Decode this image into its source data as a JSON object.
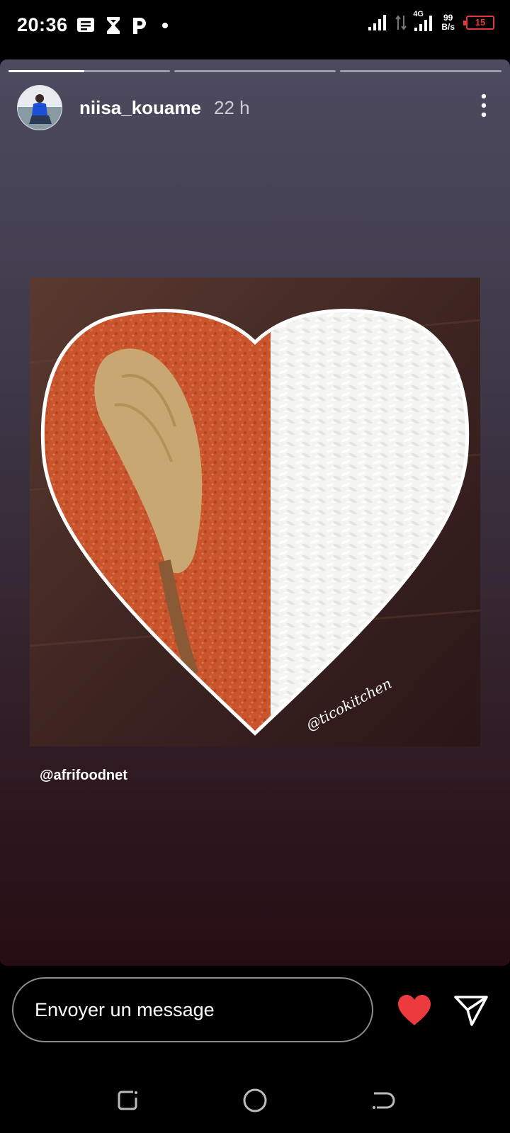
{
  "status_bar": {
    "time": "20:36",
    "network_type": "4G",
    "net_speed_value": "99",
    "net_speed_unit": "B/s",
    "battery_level": "15",
    "battery_color": "#e23a3a",
    "icons": [
      "message-notification-icon",
      "hourglass-icon",
      "p-app-icon",
      "dot-icon",
      "signal-icon",
      "data-arrows-icon",
      "signal-4g-icon",
      "battery-icon"
    ]
  },
  "story": {
    "progress_segments": [
      0.47,
      0,
      0
    ],
    "username": "niisa_kouame",
    "time_ago": "22 h",
    "mention": "@afrifoodnet",
    "image_watermark": "@ticokitchen",
    "background_colors": [
      "#4d4b60",
      "#260d13"
    ]
  },
  "reply": {
    "placeholder": "Envoyer un message",
    "heart_color": "#ed3a3f"
  },
  "nav_bar": {
    "buttons": [
      "recents-icon",
      "home-icon",
      "back-icon"
    ]
  }
}
